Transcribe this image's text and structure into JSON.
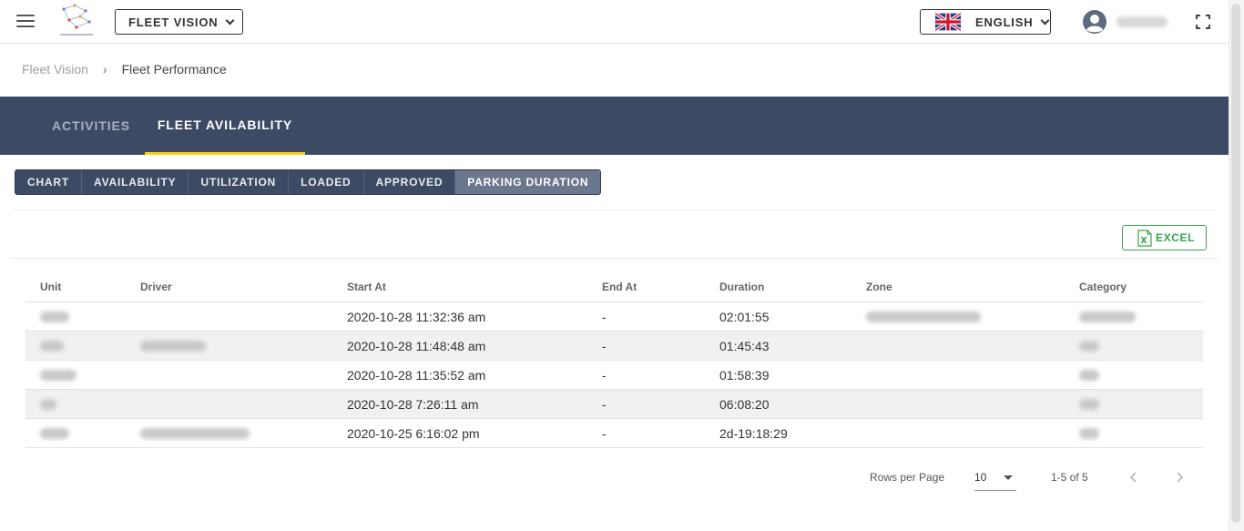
{
  "header": {
    "fleet_select_label": "FLEET VISION",
    "language_label": "ENGLISH"
  },
  "breadcrumb": {
    "root": "Fleet Vision",
    "separator": "›",
    "current": "Fleet Performance"
  },
  "tabs": [
    {
      "label": "ACTIVITIES",
      "active": false
    },
    {
      "label": "FLEET AVILABILITY",
      "active": true
    }
  ],
  "segments": [
    {
      "label": "CHART",
      "active": false
    },
    {
      "label": "AVAILABILITY",
      "active": false
    },
    {
      "label": "UTILIZATION",
      "active": false
    },
    {
      "label": "LOADED",
      "active": false
    },
    {
      "label": "APPROVED",
      "active": false
    },
    {
      "label": "PARKING DURATION",
      "active": true
    }
  ],
  "excel_label": "EXCEL",
  "table": {
    "headers": [
      "Unit",
      "Driver",
      "Start At",
      "End At",
      "Duration",
      "Zone",
      "Category"
    ],
    "rows": [
      {
        "start": "2020-10-28 11:32:36 am",
        "end": "-",
        "duration": "02:01:55"
      },
      {
        "start": "2020-10-28 11:48:48 am",
        "end": "-",
        "duration": "01:45:43"
      },
      {
        "start": "2020-10-28 11:35:52 am",
        "end": "-",
        "duration": "01:58:39"
      },
      {
        "start": "2020-10-28 7:26:11 am",
        "end": "-",
        "duration": "06:08:20"
      },
      {
        "start": "2020-10-25 6:16:02 pm",
        "end": "-",
        "duration": "2d-19:18:29"
      }
    ]
  },
  "pagination": {
    "rows_per_page_label": "Rows per Page",
    "rows_per_page_value": "10",
    "range": "1-5 of 5"
  },
  "colors": {
    "tab_bar": "#3c4a63",
    "tab_indicator": "#f3d21a",
    "excel_green": "#3aa34a"
  }
}
